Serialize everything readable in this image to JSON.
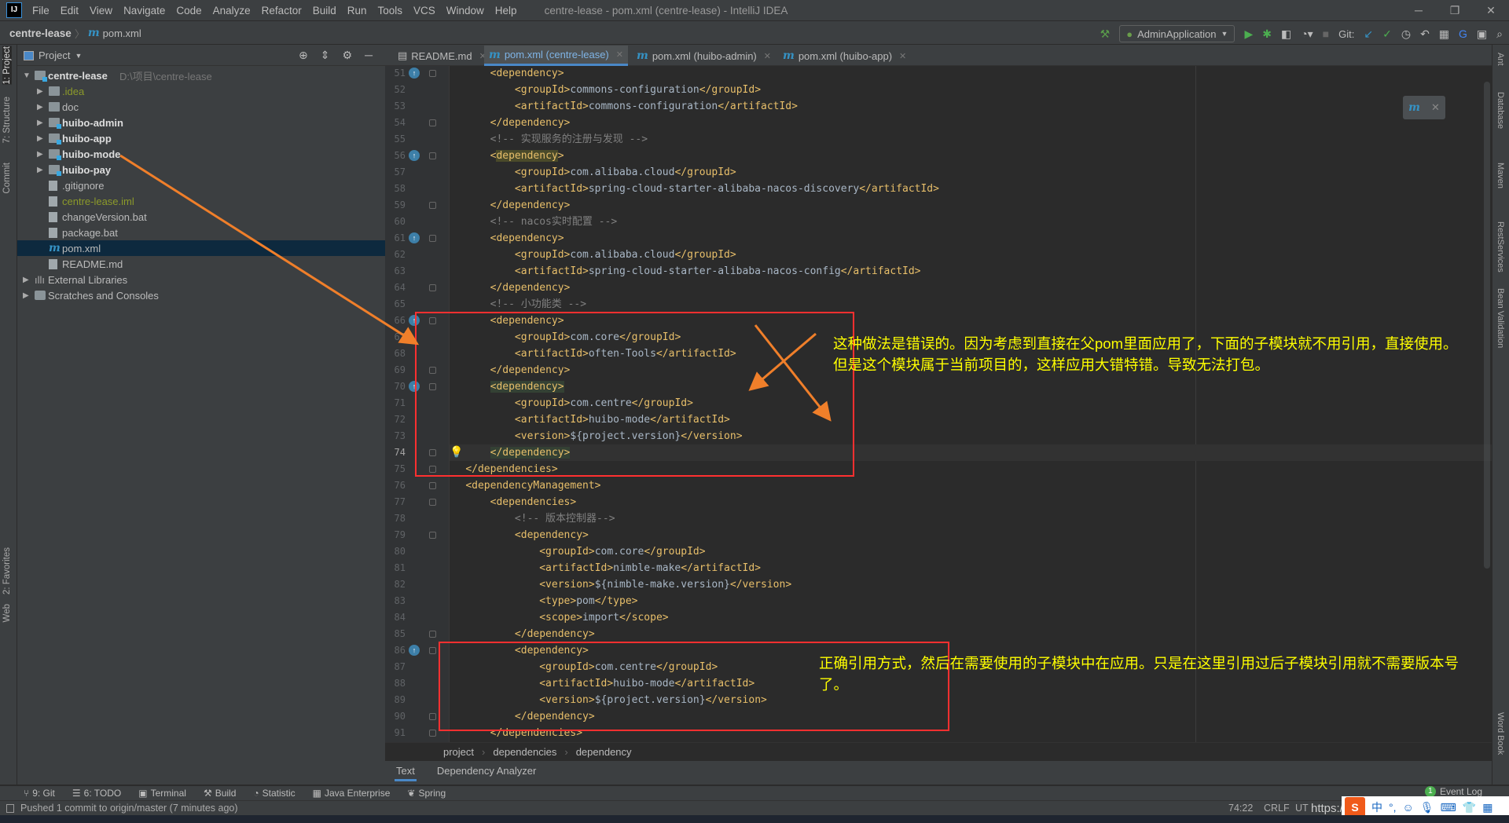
{
  "menubar": {
    "items": [
      "File",
      "Edit",
      "View",
      "Navigate",
      "Code",
      "Analyze",
      "Refactor",
      "Build",
      "Run",
      "Tools",
      "VCS",
      "Window",
      "Help"
    ],
    "title": "centre-lease - pom.xml (centre-lease) - IntelliJ IDEA",
    "logo": "IJ"
  },
  "navbar": {
    "project": "centre-lease",
    "file": "pom.xml"
  },
  "runbar": {
    "config": "AdminApplication",
    "git_label": "Git:"
  },
  "left_stripe": [
    "1: Project",
    "7: Structure",
    "Commit",
    "2: Favorites",
    "Web"
  ],
  "right_stripe": [
    "Ant",
    "Database",
    "Maven",
    "RestServices",
    "Bean Validation",
    "Word Book"
  ],
  "project_panel": {
    "title": "Project",
    "tree": [
      {
        "label": "centre-lease",
        "path": "D:\\项目\\centre-lease",
        "level": 0,
        "type": "module",
        "expanded": true,
        "bold": true
      },
      {
        "label": ".idea",
        "level": 1,
        "type": "folder",
        "color": "#8c9a2a"
      },
      {
        "label": "doc",
        "level": 1,
        "type": "folder"
      },
      {
        "label": "huibo-admin",
        "level": 1,
        "type": "module",
        "bold": true
      },
      {
        "label": "huibo-app",
        "level": 1,
        "type": "module",
        "bold": true
      },
      {
        "label": "huibo-mode",
        "level": 1,
        "type": "module",
        "bold": true
      },
      {
        "label": "huibo-pay",
        "level": 1,
        "type": "module",
        "bold": true
      },
      {
        "label": ".gitignore",
        "level": 1,
        "type": "file"
      },
      {
        "label": "centre-lease.iml",
        "level": 1,
        "type": "file",
        "color": "#8c9a2a"
      },
      {
        "label": "changeVersion.bat",
        "level": 1,
        "type": "file"
      },
      {
        "label": "package.bat",
        "level": 1,
        "type": "file"
      },
      {
        "label": "pom.xml",
        "level": 1,
        "type": "maven",
        "selected": true
      },
      {
        "label": "README.md",
        "level": 1,
        "type": "md"
      },
      {
        "label": "External Libraries",
        "level": 0,
        "type": "libs"
      },
      {
        "label": "Scratches and Consoles",
        "level": 0,
        "type": "scratch"
      }
    ]
  },
  "tabs": [
    {
      "label": "README.md",
      "icon": "markdown-icon"
    },
    {
      "label": "pom.xml (centre-lease)",
      "icon": "maven-icon",
      "active": true
    },
    {
      "label": "pom.xml (huibo-admin)",
      "icon": "maven-icon"
    },
    {
      "label": "pom.xml (huibo-app)",
      "icon": "maven-icon"
    }
  ],
  "editor": {
    "current_line": 74,
    "lines": [
      {
        "n": 51,
        "code": "        <dependency>",
        "gutter": "override"
      },
      {
        "n": 52,
        "code": "            <groupId>commons-configuration</groupId>"
      },
      {
        "n": 53,
        "code": "            <artifactId>commons-configuration</artifactId>"
      },
      {
        "n": 54,
        "code": "        </dependency>"
      },
      {
        "n": 55,
        "code": "        <!-- 实现服务的注册与发现 -->"
      },
      {
        "n": 56,
        "code": "        <dependency>",
        "gutter": "override",
        "highlight": "match"
      },
      {
        "n": 57,
        "code": "            <groupId>com.alibaba.cloud</groupId>"
      },
      {
        "n": 58,
        "code": "            <artifactId>spring-cloud-starter-alibaba-nacos-discovery</artifactId>"
      },
      {
        "n": 59,
        "code": "        </dependency>"
      },
      {
        "n": 60,
        "code": "        <!-- nacos实时配置 -->"
      },
      {
        "n": 61,
        "code": "        <dependency>",
        "gutter": "override"
      },
      {
        "n": 62,
        "code": "            <groupId>com.alibaba.cloud</groupId>"
      },
      {
        "n": 63,
        "code": "            <artifactId>spring-cloud-starter-alibaba-nacos-config</artifactId>"
      },
      {
        "n": 64,
        "code": "        </dependency>"
      },
      {
        "n": 65,
        "code": "        <!-- 小功能类 -->"
      },
      {
        "n": 66,
        "code": "        <dependency>",
        "gutter": "override"
      },
      {
        "n": 67,
        "code": "            <groupId>com.core</groupId>"
      },
      {
        "n": 68,
        "code": "            <artifactId>often-Tools</artifactId>"
      },
      {
        "n": 69,
        "code": "        </dependency>"
      },
      {
        "n": 70,
        "code": "        <dependency>",
        "gutter": "override",
        "highlight": "brace"
      },
      {
        "n": 71,
        "code": "            <groupId>com.centre</groupId>"
      },
      {
        "n": 72,
        "code": "            <artifactId>huibo-mode</artifactId>"
      },
      {
        "n": 73,
        "code": "            <version>${project.version}</version>"
      },
      {
        "n": 74,
        "code": "        </dependency>",
        "highlight": "brace",
        "bulb": true
      },
      {
        "n": 75,
        "code": "    </dependencies>"
      },
      {
        "n": 76,
        "code": "    <dependencyManagement>"
      },
      {
        "n": 77,
        "code": "        <dependencies>"
      },
      {
        "n": 78,
        "code": "            <!-- 版本控制器-->"
      },
      {
        "n": 79,
        "code": "            <dependency>"
      },
      {
        "n": 80,
        "code": "                <groupId>com.core</groupId>"
      },
      {
        "n": 81,
        "code": "                <artifactId>nimble-make</artifactId>"
      },
      {
        "n": 82,
        "code": "                <version>${nimble-make.version}</version>"
      },
      {
        "n": 83,
        "code": "                <type>pom</type>"
      },
      {
        "n": 84,
        "code": "                <scope>import</scope>"
      },
      {
        "n": 85,
        "code": "            </dependency>"
      },
      {
        "n": 86,
        "code": "            <dependency>",
        "gutter": "implemented"
      },
      {
        "n": 87,
        "code": "                <groupId>com.centre</groupId>"
      },
      {
        "n": 88,
        "code": "                <artifactId>huibo-mode</artifactId>"
      },
      {
        "n": 89,
        "code": "                <version>${project.version}</version>"
      },
      {
        "n": 90,
        "code": "            </dependency>"
      },
      {
        "n": 91,
        "code": "        </dependencies>"
      }
    ]
  },
  "breadcrumb": [
    "project",
    "dependencies",
    "dependency"
  ],
  "editor_bottom_tabs": [
    {
      "label": "Text",
      "active": true
    },
    {
      "label": "Dependency Analyzer"
    }
  ],
  "tool_windows": [
    "9: Git",
    "6: TODO",
    "Terminal",
    "Build",
    "Statistic",
    "Java Enterprise",
    "Spring"
  ],
  "event_log": {
    "label": "Event Log",
    "count": "1"
  },
  "status": {
    "message": "Pushed 1 commit to origin/master (7 minutes ago)",
    "position": "74:22",
    "line_sep": "CRLF",
    "encoding": "UT",
    "watermark": "https://b"
  },
  "ime": {
    "lang": "中",
    "punct": "°,"
  },
  "annotations": {
    "wrong": "这种做法是错误的。因为考虑到直接在父pom里面应用了，下面的子模块就不用引用，直接使用。",
    "wrong2": "但是这个模块属于当前项目的，这样应用大错特错。导致无法打包。",
    "right": "正确引用方式，然后在需要使用的子模块中在应用。只是在这里引用过后子模块引用就不需要版本号",
    "right2": "了。",
    "box_color": "#ff3030",
    "arrow_color": "#f07f2a",
    "text_color": "#ffff00"
  },
  "colors": {
    "tag": "#e8bf6a",
    "text": "#a9b7c6",
    "comment": "#808080",
    "editor_bg": "#2b2b2b",
    "panel_bg": "#3c3f41",
    "selection": "#0d293e",
    "accent": "#4a88c7"
  }
}
